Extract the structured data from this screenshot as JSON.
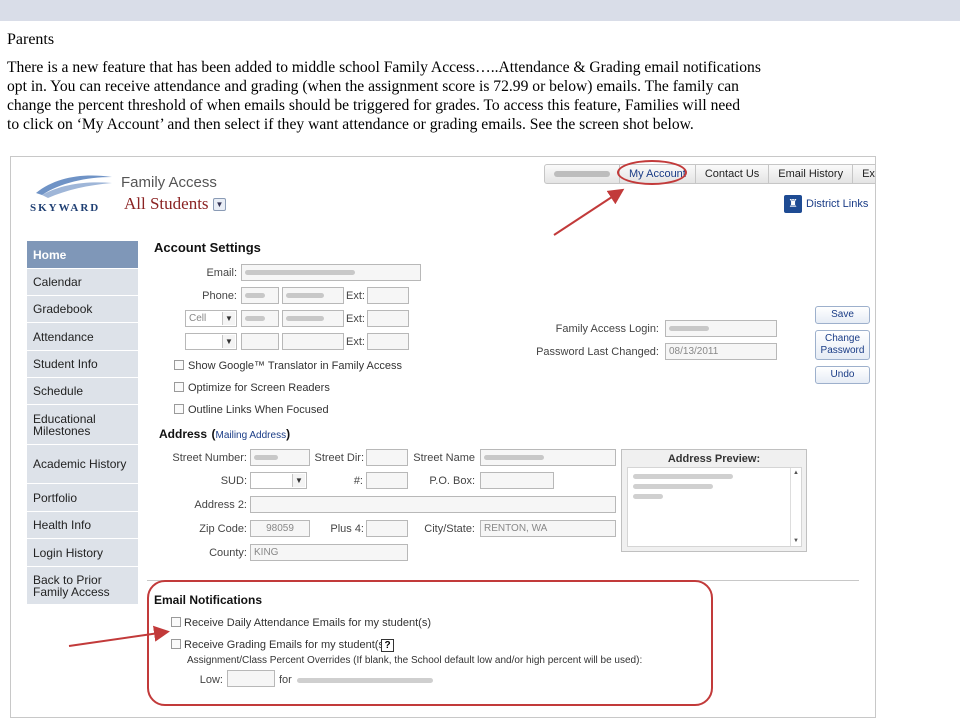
{
  "doc": {
    "heading": "Parents",
    "paragraph_lines": [
      "There is a new feature that has been added to middle school Family Access…..Attendance & Grading email notifications",
      "opt in.  You can receive attendance and grading (when the assignment score is 72.99 or below) emails.  The family can",
      "change the  percent threshold of when emails should be triggered for grades.  To access this feature, Families will need",
      "to click on ‘My Account’ and then select if they want attendance or grading emails. See the screen shot below."
    ]
  },
  "screenshot": {
    "header": {
      "logo_text": "SKYWARD",
      "app_title": "Family Access",
      "student_selector": "All Students",
      "top_links": {
        "my_account": "My Account",
        "contact_us": "Contact Us",
        "email_history": "Email History",
        "exit": "Exit"
      },
      "district_links": "District Links"
    },
    "nav": {
      "items": [
        {
          "label": "Home",
          "active": true
        },
        {
          "label": "Calendar"
        },
        {
          "label": "Gradebook"
        },
        {
          "label": "Attendance"
        },
        {
          "label": "Student Info"
        },
        {
          "label": "Schedule"
        },
        {
          "label": "Educational Milestones"
        },
        {
          "label": "Academic History"
        },
        {
          "label": "Portfolio"
        },
        {
          "label": "Health Info"
        },
        {
          "label": "Login History"
        },
        {
          "label": "Back to Prior Family Access"
        }
      ]
    },
    "account": {
      "title": "Account Settings",
      "email_label": "Email:",
      "phone_label": "Phone:",
      "ext_label": "Ext:",
      "cell_option": "Cell",
      "show_translator": "Show Google™ Translator in Family Access",
      "optimize_readers": "Optimize for Screen Readers",
      "outline_links": "Outline Links When Focused",
      "login_label": "Family Access Login:",
      "password_changed_label": "Password Last Changed:",
      "password_changed_value": "08/13/2011",
      "buttons": {
        "save": "Save",
        "change_password": "Change Password",
        "undo": "Undo"
      }
    },
    "address": {
      "title": "Address",
      "mailing_link": "Mailing Address",
      "street_number": "Street Number:",
      "street_dir": "Street Dir:",
      "street_name": "Street Name",
      "sud": "SUD:",
      "hash": "#:",
      "po_box": "P.O. Box:",
      "address2": "Address 2:",
      "zip_label": "Zip Code:",
      "zip_value": "98059",
      "plus4": "Plus 4:",
      "city_state_label": "City/State:",
      "city_state_value": "RENTON, WA",
      "county_label": "County:",
      "county_value": "KING",
      "preview_title": "Address Preview:"
    },
    "email_notifications": {
      "title": "Email Notifications",
      "attendance": "Receive Daily Attendance Emails for my student(s)",
      "grading": "Receive Grading Emails for my student(s)",
      "help": "?",
      "overrides": "Assignment/Class Percent Overrides (If blank, the School default low and/or high percent will be used):",
      "low_label": "Low:",
      "for_label": "for"
    }
  },
  "colors": {
    "annotation_red": "#c23a3a",
    "nav_active": "#7f97b8",
    "nav_bg": "#dde2e9",
    "link_blue": "#1a3c86",
    "student_name": "#8b2323"
  }
}
